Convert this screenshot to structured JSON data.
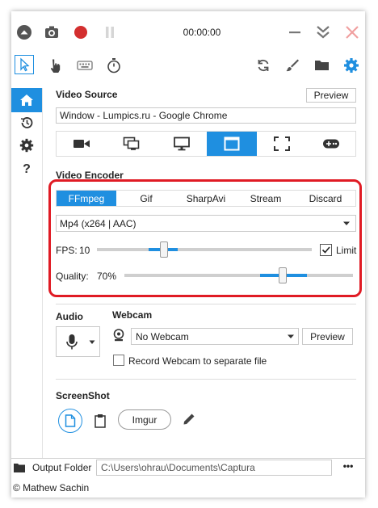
{
  "titlebar": {
    "timer": "00:00:00"
  },
  "video_source": {
    "heading": "Video Source",
    "preview_label": "Preview",
    "source_text": "Window  -  Lumpics.ru - Google Chrome",
    "source_types": [
      "camera-icon",
      "screens-icon",
      "monitor-icon",
      "window-icon",
      "region-icon",
      "gamepad-icon"
    ],
    "selected_index": 3
  },
  "video_encoder": {
    "heading": "Video Encoder",
    "tabs": [
      "FFmpeg",
      "Gif",
      "SharpAvi",
      "Stream",
      "Discard"
    ],
    "selected_tab": 0,
    "codec": "Mp4 (x264 | AAC)",
    "fps_label": "FPS:",
    "fps_value": "10",
    "limit_label": "Limit",
    "limit_checked": true,
    "quality_label": "Quality:",
    "quality_value": "70%",
    "quality_fraction": 0.7
  },
  "audio": {
    "heading": "Audio"
  },
  "webcam": {
    "heading": "Webcam",
    "selected": "No Webcam",
    "preview_label": "Preview",
    "separate_file_label": "Record Webcam to separate file"
  },
  "screenshot": {
    "heading": "ScreenShot",
    "imgur_label": "Imgur"
  },
  "footer": {
    "output_folder_label": "Output Folder",
    "output_path": "C:\\Users\\ohrau\\Documents\\Captura",
    "more_label": "•••",
    "copyright": "© Mathew Sachin"
  },
  "colors": {
    "accent": "#1f8fe0",
    "highlight_border": "#e01b24",
    "record": "#d32f2f"
  }
}
